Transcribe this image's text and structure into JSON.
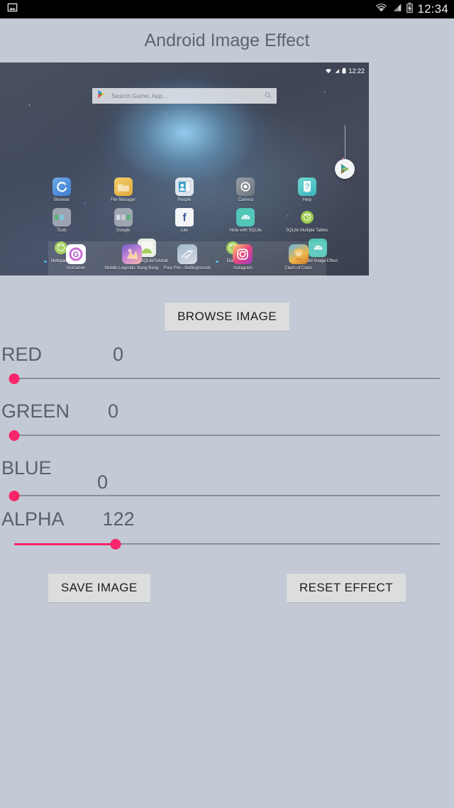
{
  "statusbar": {
    "left_icon": "photo-icon",
    "wifi_icon": "wifi-icon",
    "signal_icon": "cellular-signal-icon",
    "battery_icon": "battery-charging-icon",
    "clock": "12:34"
  },
  "actionbar": {
    "title": "Android Image Effect"
  },
  "preview": {
    "mini_clock": "12:22",
    "search_placeholder": "Search Game, App...",
    "search_icon": "magnifier-icon",
    "play_store_icon": "play-store-icon",
    "rows": [
      [
        {
          "label": "Browser",
          "icon": "browser-icon",
          "new": false
        },
        {
          "label": "File Manager",
          "icon": "folder-icon",
          "new": false
        },
        {
          "label": "People",
          "icon": "contacts-icon",
          "new": false
        },
        {
          "label": "Camera",
          "icon": "camera-icon",
          "new": false
        },
        {
          "label": "Help",
          "icon": "help-icon",
          "new": false
        }
      ],
      [
        {
          "label": "Tools",
          "icon": "folder-group-icon",
          "new": false
        },
        {
          "label": "Google",
          "icon": "folder-group-icon",
          "new": false
        },
        {
          "label": "Lite",
          "icon": "facebook-icon",
          "new": false
        },
        {
          "label": "Note with SQLite",
          "icon": "android-app-icon",
          "new": false
        },
        {
          "label": "SQLite Multiple Tables",
          "icon": "android-robot-icon",
          "new": false
        }
      ],
      [
        {
          "label": "Notepad 2",
          "icon": "android-robot-icon",
          "new": true
        },
        {
          "label": "AndroidSQLiteTutorial",
          "icon": "android-studio-icon",
          "new": true
        },
        {
          "label": "Dialog",
          "icon": "android-robot-icon",
          "new": true
        },
        {
          "label": "Android Image Effect",
          "icon": "android-app-icon",
          "new": true
        }
      ]
    ],
    "dock": [
      {
        "label": "IcoGamer",
        "icon": "icogamer-icon"
      },
      {
        "label": "Mobile Legends: Bang Bang",
        "icon": "mobile-legends-icon"
      },
      {
        "label": "Free Fire - Battlegrounds",
        "icon": "free-fire-icon"
      },
      {
        "label": "Instagram",
        "icon": "instagram-icon"
      },
      {
        "label": "Clash of Clans",
        "icon": "clash-of-clans-icon"
      }
    ]
  },
  "controls": {
    "browse_label": "BROWSE IMAGE",
    "save_label": "SAVE IMAGE",
    "reset_label": "RESET EFFECT",
    "accent_color": "#f9266b",
    "track_color": "#8b8f99",
    "sliders": [
      {
        "name": "RED",
        "value": "0",
        "fraction": 0.0
      },
      {
        "name": "GREEN",
        "value": "0",
        "fraction": 0.0
      },
      {
        "name": "BLUE",
        "value": "0",
        "fraction": 0.0
      },
      {
        "name": "ALPHA",
        "value": "122",
        "fraction": 0.239
      }
    ]
  }
}
